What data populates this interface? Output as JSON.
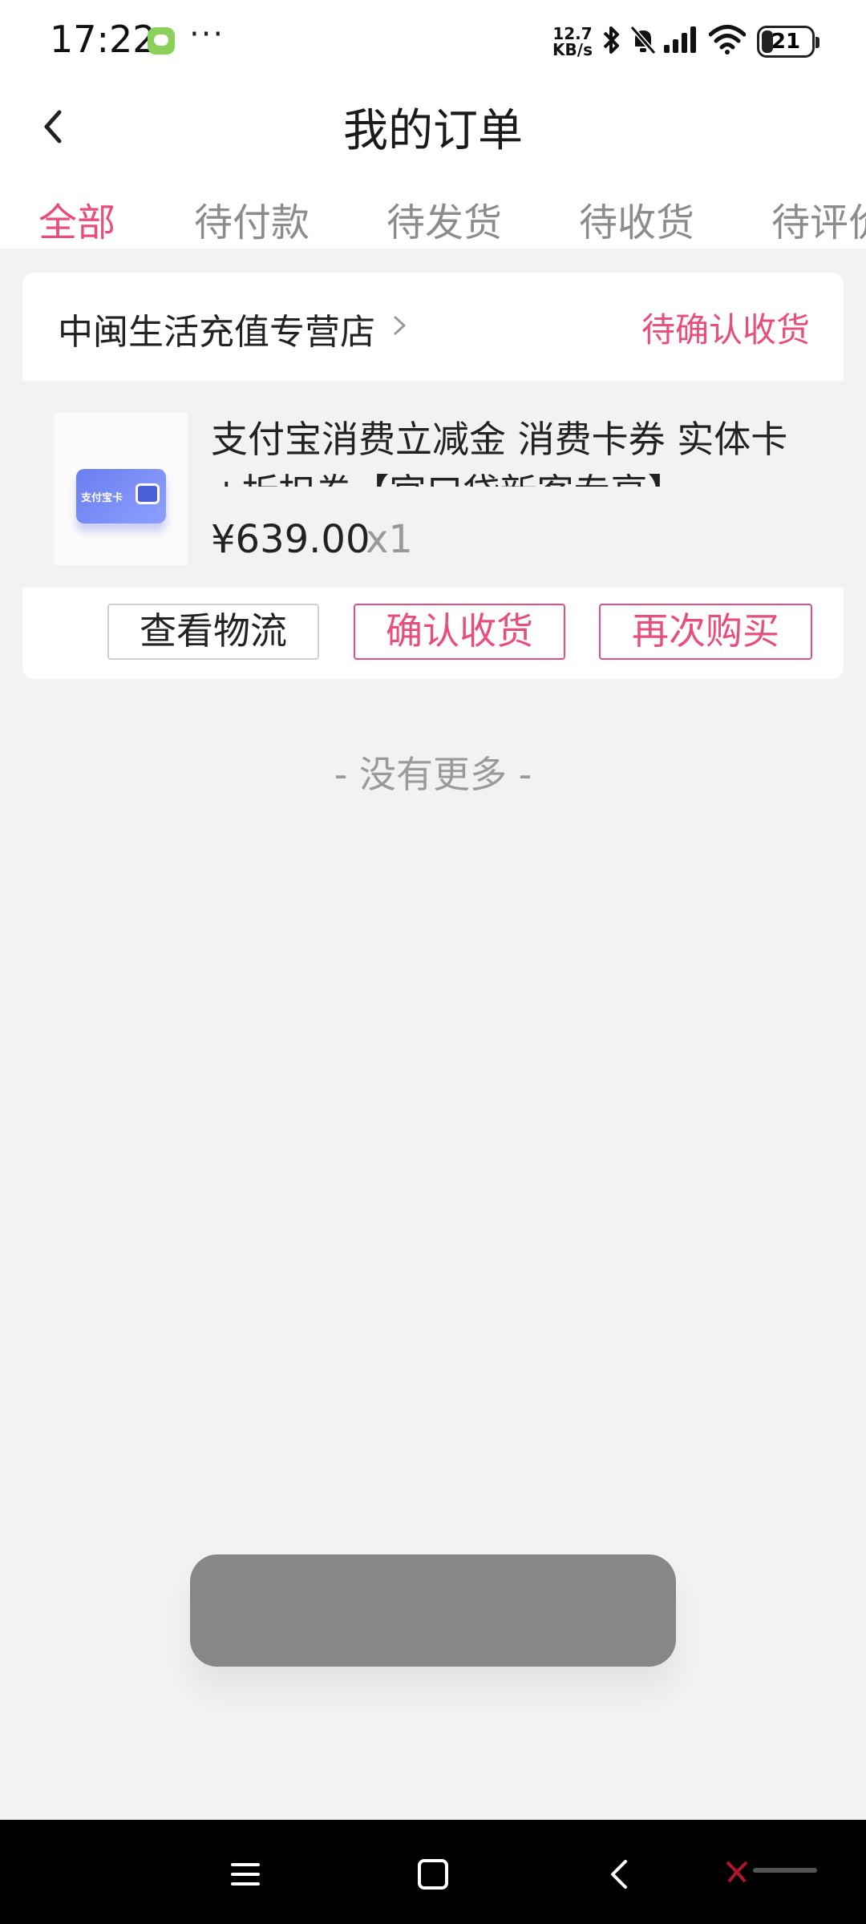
{
  "status_bar": {
    "time": "17:22",
    "more": "···",
    "speed_value": "12.7",
    "speed_unit": "KB/s",
    "battery": "21",
    "icons": [
      "message-icon",
      "bluetooth-icon",
      "mute-icon",
      "signal-icon",
      "wifi-icon",
      "battery-icon"
    ]
  },
  "header": {
    "title": "我的订单"
  },
  "tabs": [
    {
      "label": "全部",
      "active": true
    },
    {
      "label": "待付款",
      "active": false
    },
    {
      "label": "待发货",
      "active": false
    },
    {
      "label": "待收货",
      "active": false
    },
    {
      "label": "待评价",
      "active": false
    }
  ],
  "order": {
    "store_name": "中闽生活充值专营店",
    "status": "待确认收货",
    "thumbnail_label": "支付宝卡",
    "product_title": "支付宝消费立减金 消费卡券 实体卡+折扣券【官口袋新客专享】",
    "price": "¥639.00",
    "quantity": "x1",
    "buttons": {
      "logistics": "查看物流",
      "confirm": "确认收货",
      "rebuy": "再次购买"
    }
  },
  "list_end": "- 没有更多 -",
  "colors": {
    "accent": "#e84e7c",
    "background": "#f2f2f2",
    "toast": "#878787"
  }
}
